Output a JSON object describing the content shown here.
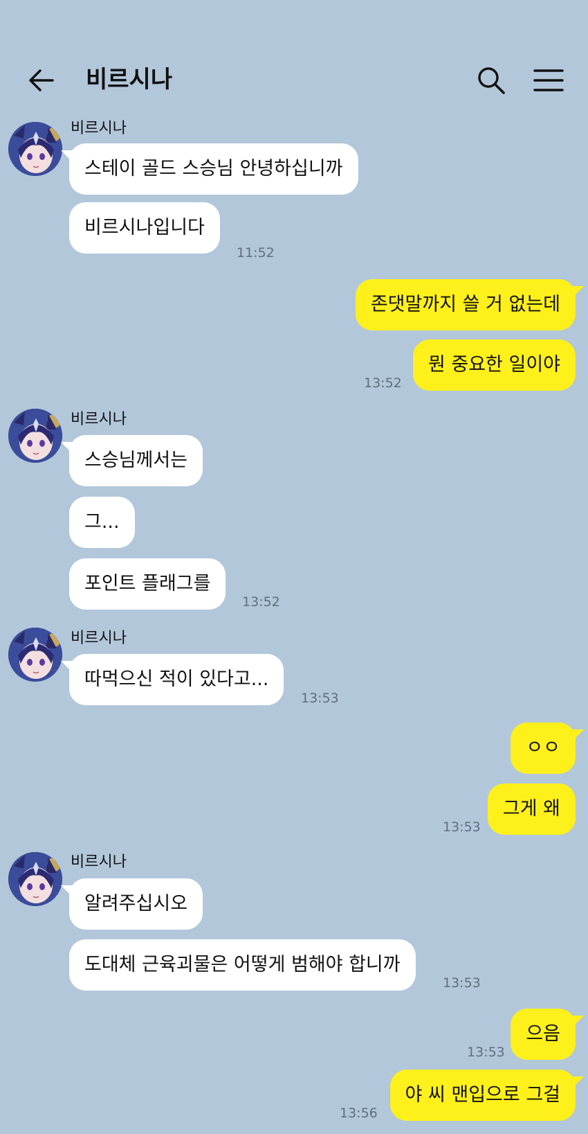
{
  "header": {
    "title": "비르시나",
    "back_icon": "back-arrow-icon",
    "search_icon": "search-icon",
    "menu_icon": "hamburger-menu-icon"
  },
  "colors": {
    "background": "#b2c7da",
    "incoming_bubble": "#ffffff",
    "outgoing_bubble": "#fef01b",
    "timestamp": "#5f6e7c"
  },
  "messages": {
    "g1": {
      "sender": "비르시나",
      "m1": "스테이 골드 스승님 안녕하십니까",
      "m2": "비르시나입니다",
      "time": "11:52"
    },
    "g2": {
      "m1": "존댓말까지 쓸 거 없는데",
      "m2": "뭔 중요한 일이야",
      "time": "13:52"
    },
    "g3": {
      "sender": "비르시나",
      "m1": "스승님께서는",
      "m2": "그...",
      "m3": "포인트 플래그를",
      "time": "13:52"
    },
    "g4": {
      "sender": "비르시나",
      "m1": "따먹으신 적이 있다고...",
      "time": "13:53"
    },
    "g5": {
      "m1": "ㅇㅇ",
      "m2": "그게 왜",
      "time": "13:53"
    },
    "g6": {
      "sender": "비르시나",
      "m1": "알려주십시오",
      "m2": "도대체 근육괴물은 어떻게 범해야 합니까",
      "time": "13:53"
    },
    "g7": {
      "m1": "으음",
      "time": "13:53"
    },
    "g8": {
      "m1": "야 씨 맨입으로 그걸",
      "time": "13:56"
    }
  }
}
